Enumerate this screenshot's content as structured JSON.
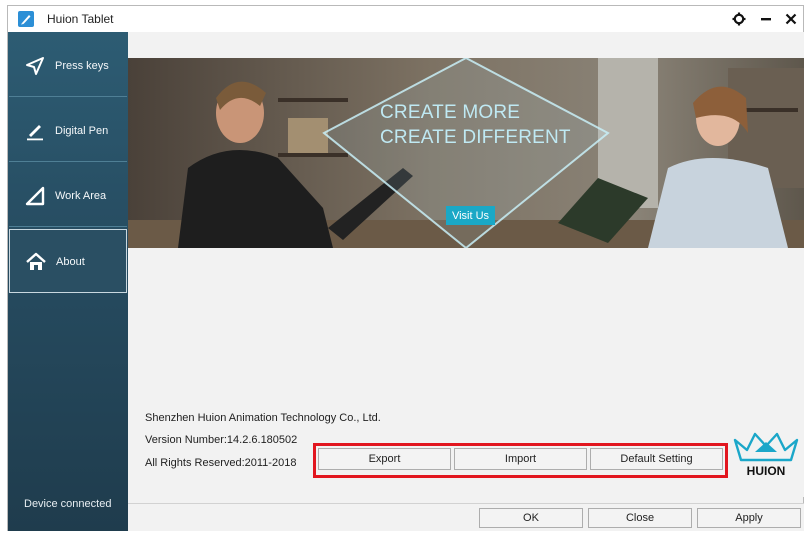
{
  "window": {
    "title": "Huion Tablet"
  },
  "sidebar": {
    "items": [
      {
        "label": "Press keys"
      },
      {
        "label": "Digital Pen"
      },
      {
        "label": "Work Area"
      },
      {
        "label": "About"
      }
    ],
    "status": "Device connected"
  },
  "banner": {
    "line1": "CREATE MORE",
    "line2": "CREATE DIFFERENT",
    "visit_label": "Visit Us"
  },
  "about": {
    "company": "Shenzhen Huion Animation Technology Co., Ltd.",
    "version": "Version Number:14.2.6.180502",
    "rights": "All Rights Reserved:2011-2018"
  },
  "actions": {
    "export": "Export",
    "import": "Import",
    "default": "Default Setting"
  },
  "footer": {
    "ok": "OK",
    "close": "Close",
    "apply": "Apply"
  },
  "logo": {
    "text": "HUION"
  },
  "colors": {
    "sidebar": "#2d5c73",
    "accent": "#1aa8c6",
    "highlight": "#e2161f"
  }
}
